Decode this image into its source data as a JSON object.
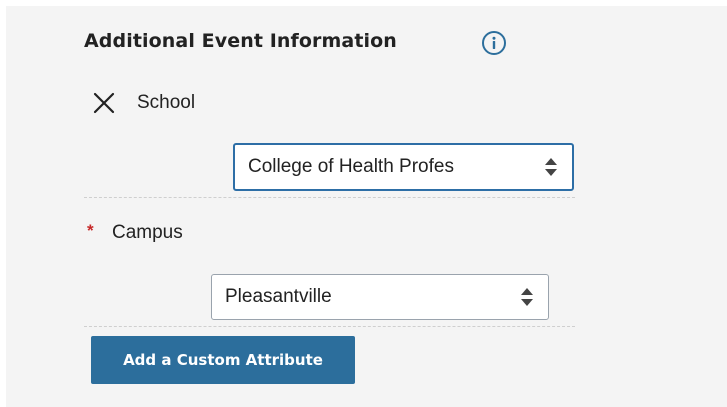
{
  "section": {
    "title": "Additional Event Information",
    "info_icon": "info-circle-icon"
  },
  "school": {
    "remove_icon": "close-icon",
    "label": "School",
    "selected": "College of Health Profes"
  },
  "campus": {
    "required_marker": "*",
    "label": "Campus",
    "selected": "Pleasantville"
  },
  "actions": {
    "add_custom_attribute_label": "Add a Custom Attribute"
  },
  "colors": {
    "accent": "#2c6e9c",
    "focus_border": "#2d6ea6",
    "required": "#c62828",
    "panel_background": "#f4f4f4"
  }
}
